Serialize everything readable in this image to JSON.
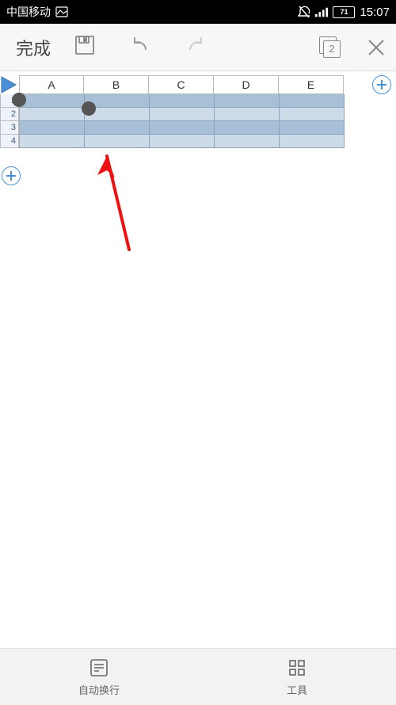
{
  "status_bar": {
    "carrier": "中国移动",
    "battery": "71",
    "time": "15:07"
  },
  "titlebar": {
    "done_label": "完成",
    "copy_badge": "2"
  },
  "sheet": {
    "columns": [
      "A",
      "B",
      "C",
      "D",
      "E"
    ],
    "rows": [
      "1",
      "2",
      "3",
      "4"
    ]
  },
  "bottombar": {
    "wrap_label": "自动换行",
    "tools_label": "工具"
  }
}
